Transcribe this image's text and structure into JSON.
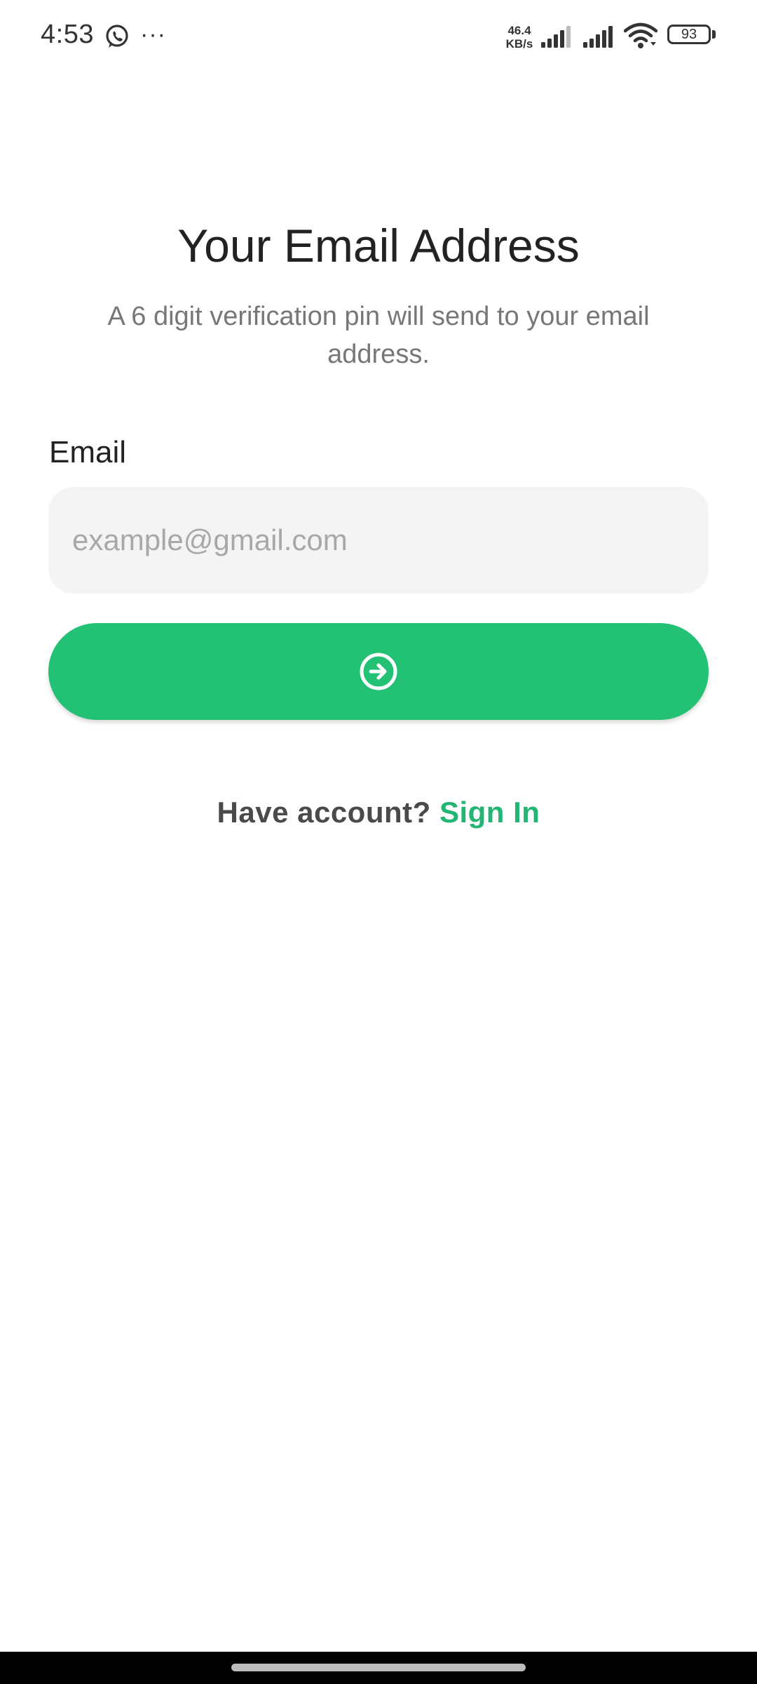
{
  "status_bar": {
    "time": "4:53",
    "more": "···",
    "speed_value": "46.4",
    "speed_unit": "KB/s",
    "battery": "93",
    "icons": [
      "whatsapp-icon",
      "signal-icon",
      "signal-icon",
      "wifi-icon",
      "battery-icon"
    ]
  },
  "screen": {
    "title": "Your Email Address",
    "subtitle": "A 6 digit verification pin will send to your email address."
  },
  "form": {
    "email_label": "Email",
    "email_value": "",
    "email_placeholder": "example@gmail.com",
    "submit_icon": "arrow-right-circle-icon"
  },
  "footer": {
    "prompt": "Have account?",
    "link": "Sign In"
  },
  "colors": {
    "accent": "#22c174",
    "link": "#22b573",
    "input_bg": "#f4f4f4",
    "title": "#222222",
    "subtitle": "#777777"
  }
}
